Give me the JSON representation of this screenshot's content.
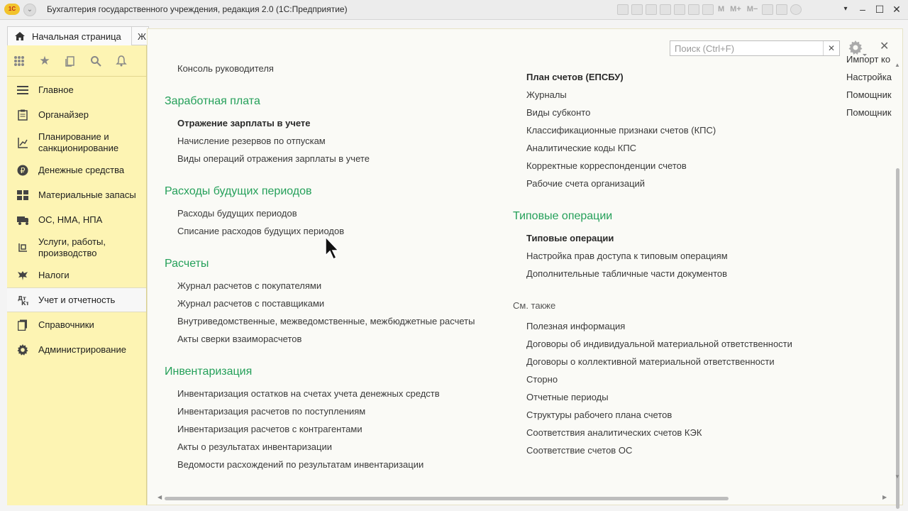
{
  "window": {
    "title": "Бухгалтерия государственного учреждения, редакция 2.0  (1С:Предприятие)",
    "logo_text": "1С",
    "toolbar_tools": [
      "table-icon",
      "print-icon",
      "preview-icon",
      "upload-icon",
      "calendar-icon",
      "calc-icon",
      "document-icon",
      "M",
      "M+",
      "M−",
      "zoom-icon",
      "panel-icon",
      "info-icon"
    ]
  },
  "tabs": {
    "home_label": "Начальная страница",
    "next_label": "Ж"
  },
  "sidebar": {
    "tools": [
      "apps-grid-icon",
      "star-icon",
      "history-icon",
      "search-icon",
      "bell-icon"
    ],
    "items": [
      {
        "label": "Главное",
        "icon": "menu-lines-icon"
      },
      {
        "label": "Органайзер",
        "icon": "clipboard-icon"
      },
      {
        "label": "Планирование и санкционирование",
        "icon": "planning-icon"
      },
      {
        "label": "Денежные средства",
        "icon": "ruble-icon"
      },
      {
        "label": "Материальные запасы",
        "icon": "blocks-icon"
      },
      {
        "label": "ОС, НМА, НПА",
        "icon": "truck-icon"
      },
      {
        "label": "Услуги, работы, производство",
        "icon": "services-icon"
      },
      {
        "label": "Налоги",
        "icon": "eagle-icon"
      },
      {
        "label": "Учет и отчетность",
        "icon": "accounting-icon"
      },
      {
        "label": "Справочники",
        "icon": "books-icon"
      },
      {
        "label": "Администрирование",
        "icon": "gear-icon"
      }
    ],
    "active_index": 8
  },
  "panel": {
    "search_placeholder": "Поиск (Ctrl+F)",
    "col1": {
      "top_link": "Консоль руководителя",
      "groups": [
        {
          "title": "Заработная плата",
          "links": [
            "Отражение зарплаты в учете",
            "Начисление резервов по отпускам",
            "Виды операций отражения зарплаты в учете"
          ]
        },
        {
          "title": "Расходы будущих периодов",
          "links": [
            "Расходы будущих периодов",
            "Списание расходов будущих периодов"
          ]
        },
        {
          "title": "Расчеты",
          "links": [
            "Журнал расчетов с покупателями",
            "Журнал расчетов с поставщиками",
            "Внутриведомственные, межведомственные, межбюджетные расчеты",
            "Акты сверки взаиморасчетов"
          ]
        },
        {
          "title": "Инвентаризация",
          "links": [
            "Инвентаризация остатков на счетах учета денежных средств",
            "Инвентаризация расчетов по поступлениям",
            "Инвентаризация расчетов с контрагентами",
            "Акты о результатах инвентаризации",
            "Ведомости расхождений по результатам инвентаризации"
          ]
        }
      ]
    },
    "col2": {
      "top_links": [
        "План счетов (ЕПСБУ)",
        "Журналы",
        "Виды субконто",
        "Классификационные признаки счетов (КПС)",
        "Аналитические коды КПС",
        "Корректные корреспонденции счетов",
        "Рабочие счета организаций"
      ],
      "typical": {
        "title": "Типовые операции",
        "links": [
          "Типовые операции",
          "Настройка прав доступа к типовым операциям",
          "Дополнительные табличные части документов"
        ]
      },
      "see_also": {
        "title": "См. также",
        "links": [
          "Полезная информация",
          "Договоры об индивидуальной материальной ответственности",
          "Договоры о коллективной материальной ответственности",
          "Сторно",
          "Отчетные периоды",
          "Структуры рабочего плана счетов",
          "Соответствия аналитических счетов КЭК",
          "Соответствие счетов ОС"
        ]
      }
    },
    "col3": {
      "links": [
        "Импорт ко",
        "Настройка",
        "Помощник",
        "Помощник"
      ]
    }
  },
  "colors": {
    "sidebar_bg": "#fdf4b3",
    "group_title": "#25a05a",
    "panel_bg": "#fafaf6"
  }
}
